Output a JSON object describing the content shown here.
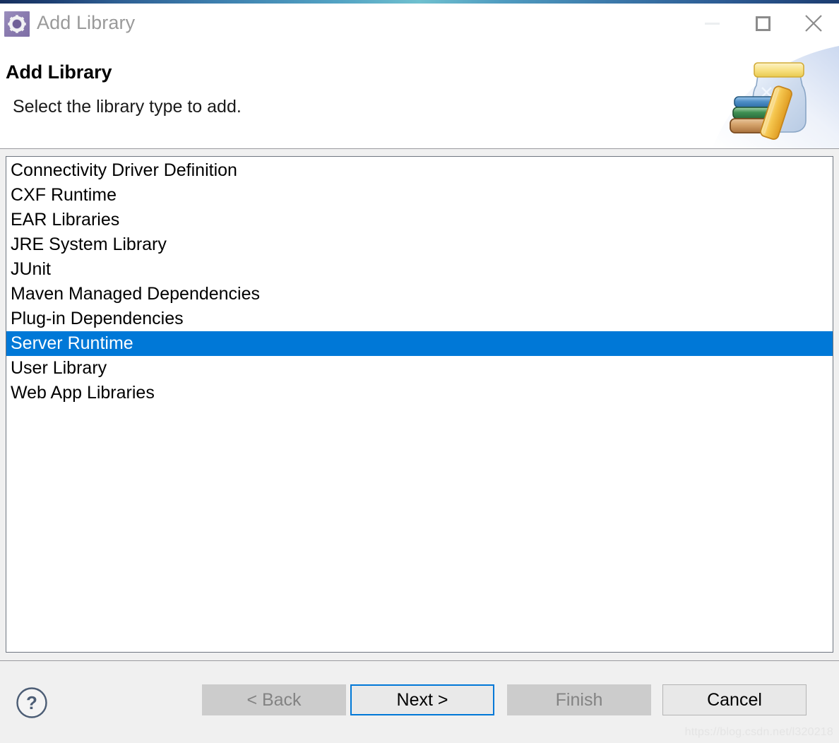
{
  "window": {
    "title": "Add Library",
    "app_icon": "gear-icon",
    "accent_color": "#17305e",
    "controls": {
      "minimize_label": "Minimize",
      "maximize_label": "Maximize",
      "close_label": "Close"
    }
  },
  "banner": {
    "title": "Add Library",
    "subtitle": "Select the library type to add.",
    "image_name": "jar-with-books-icon"
  },
  "list": {
    "selected_index": 7,
    "selection_color": "#0078d7",
    "items": [
      {
        "label": "Connectivity Driver Definition"
      },
      {
        "label": "CXF Runtime"
      },
      {
        "label": "EAR Libraries"
      },
      {
        "label": "JRE System Library"
      },
      {
        "label": "JUnit"
      },
      {
        "label": "Maven Managed Dependencies"
      },
      {
        "label": "Plug-in Dependencies"
      },
      {
        "label": "Server Runtime"
      },
      {
        "label": "User Library"
      },
      {
        "label": "Web App Libraries"
      }
    ]
  },
  "buttons": {
    "help": "?",
    "back": "< Back",
    "next": "Next >",
    "finish": "Finish",
    "cancel": "Cancel"
  },
  "watermark": {
    "text": "https://blog.csdn.net/l320218"
  }
}
